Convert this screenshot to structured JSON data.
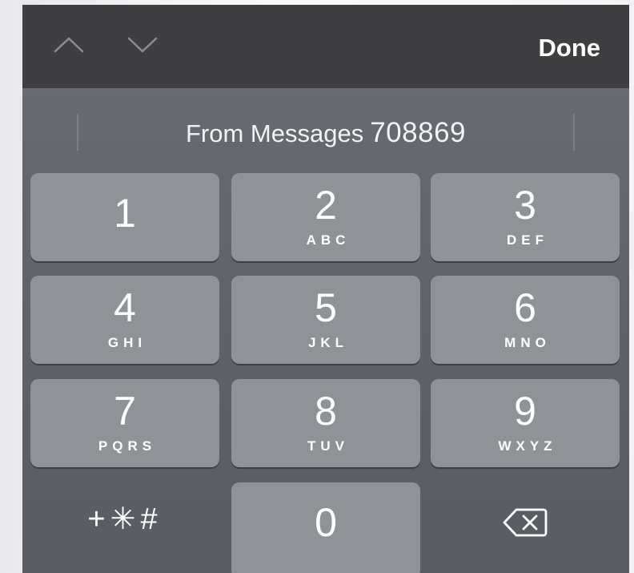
{
  "toolbar": {
    "prev_icon": "chevron-up-icon",
    "next_icon": "chevron-down-icon",
    "done_label": "Done"
  },
  "suggestion": {
    "source": "From Messages",
    "code": "708869"
  },
  "keys": [
    {
      "digit": "1",
      "letters": ""
    },
    {
      "digit": "2",
      "letters": "ABC"
    },
    {
      "digit": "3",
      "letters": "DEF"
    },
    {
      "digit": "4",
      "letters": "GHI"
    },
    {
      "digit": "5",
      "letters": "JKL"
    },
    {
      "digit": "6",
      "letters": "MNO"
    },
    {
      "digit": "7",
      "letters": "PQRS"
    },
    {
      "digit": "8",
      "letters": "TUV"
    },
    {
      "digit": "9",
      "letters": "WXYZ"
    },
    {
      "digit": "0",
      "letters": ""
    }
  ],
  "symbols_key": "+✳#",
  "delete_icon": "backspace-icon",
  "colors": {
    "toolbar_bg": "#3f3f41",
    "keyboard_bg": "#64686e",
    "key_bg": "#8f9297",
    "text": "#ffffff"
  }
}
